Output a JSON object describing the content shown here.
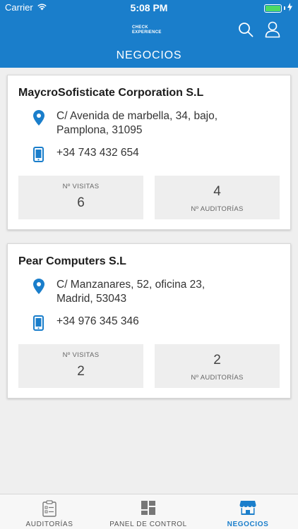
{
  "status_bar": {
    "carrier": "Carrier",
    "time": "5:08 PM"
  },
  "header": {
    "logo_line1": "CHECK",
    "logo_line2": "EXPERIENCE",
    "title": "NEGOCIOS"
  },
  "businesses": [
    {
      "name": "MaycroSofisticate Corporation S.L",
      "address_line1": "C/ Avenida de marbella, 34, bajo,",
      "address_line2": "Pamplona, 31095",
      "phone": "+34 743 432 654",
      "visits_label": "Nº VISITAS",
      "visits_value": "6",
      "audits_label": "Nº AUDITORÍAS",
      "audits_value": "4"
    },
    {
      "name": "Pear Computers S.L",
      "address_line1": "C/ Manzanares, 52, oficina 23,",
      "address_line2": "Madrid, 53043",
      "phone": "+34 976 345 346",
      "visits_label": "Nº VISITAS",
      "visits_value": "2",
      "audits_label": "Nº AUDITORÍAS",
      "audits_value": "2"
    }
  ],
  "tabbar": {
    "tabs": [
      {
        "label": "AUDITORÍAS",
        "icon": "clipboard-icon"
      },
      {
        "label": "PANEL DE CONTROL",
        "icon": "dashboard-icon"
      },
      {
        "label": "NEGOCIOS",
        "icon": "store-icon"
      }
    ],
    "active": "NEGOCIOS"
  },
  "colors": {
    "brand_blue": "#1a7ecb",
    "background": "#efefef",
    "battery_green": "#4cd964"
  }
}
